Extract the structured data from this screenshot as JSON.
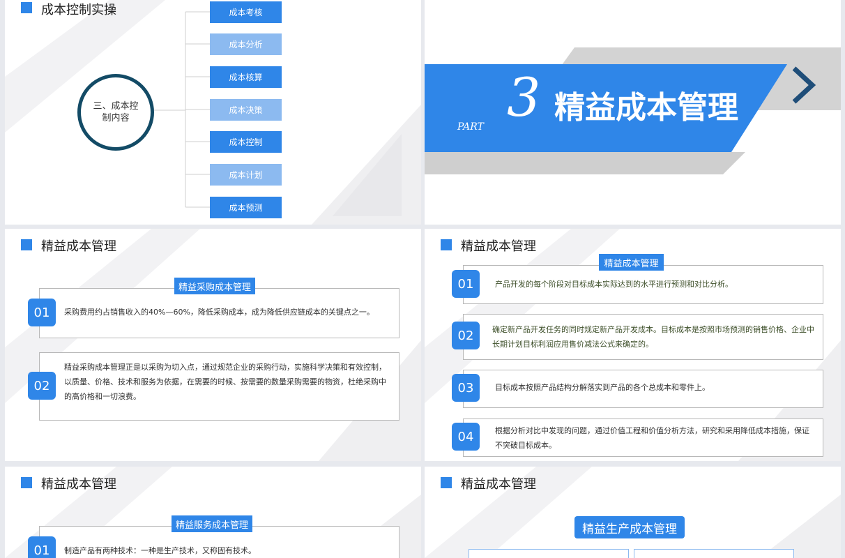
{
  "s1": {
    "title": "成本控制实操",
    "circle": "三、成本控制内容",
    "branches": [
      "成本考核",
      "成本分析",
      "成本核算",
      "成本决策",
      "成本控制",
      "成本计划",
      "成本预测"
    ]
  },
  "s2": {
    "part": "PART",
    "num": "3",
    "title": "精益成本管理",
    "chevron": "chevron-right-icon"
  },
  "s3": {
    "title": "精益成本管理",
    "tag": "精益采购成本管理",
    "items": [
      {
        "num": "01",
        "text": "采购费用约占销售收入的40%—60%，降低采购成本，成为降低供应链成本的关键点之一。"
      },
      {
        "num": "02",
        "text": "精益采购成本管理正是以采购为切入点，通过规范企业的采购行动，实施科学决策和有效控制，以质量、价格、技术和服务为依据，在需要的时候、按需要的数量采购需要的物资，杜绝采购中的高价格和一切浪费。"
      }
    ]
  },
  "s4": {
    "title": "精益成本管理",
    "tag": "精益成本管理",
    "items": [
      {
        "num": "01",
        "text": "产品开发的每个阶段对目标成本实际达到的水平进行预测和对比分析。"
      },
      {
        "num": "02",
        "text": "确定新产品开发任务的同时规定新产品开发成本。目标成本是按照市场预测的销售价格、企业中长期计划目标利润应用售价减法公式来确定的。"
      },
      {
        "num": "03",
        "text": "目标成本按照产品结构分解落实到产品的各个总成本和零件上。"
      },
      {
        "num": "04",
        "text": "根据分析对比中发现的问题，通过价值工程和价值分析方法，研究和采用降低成本措施，保证不突破目标成本。"
      }
    ]
  },
  "s5": {
    "title": "精益成本管理",
    "tag": "精益服务成本管理",
    "items": [
      {
        "num": "01",
        "text": "制造产品有两种技术：一种是生产技术，又称固有技术。"
      }
    ]
  },
  "s6": {
    "title": "精益成本管理",
    "tag": "精益生产成本管理"
  },
  "colors": {
    "accent": "#2f86e8",
    "light": "#8cbaf0",
    "navy": "#134b66",
    "grey": "#d3d3d3"
  }
}
